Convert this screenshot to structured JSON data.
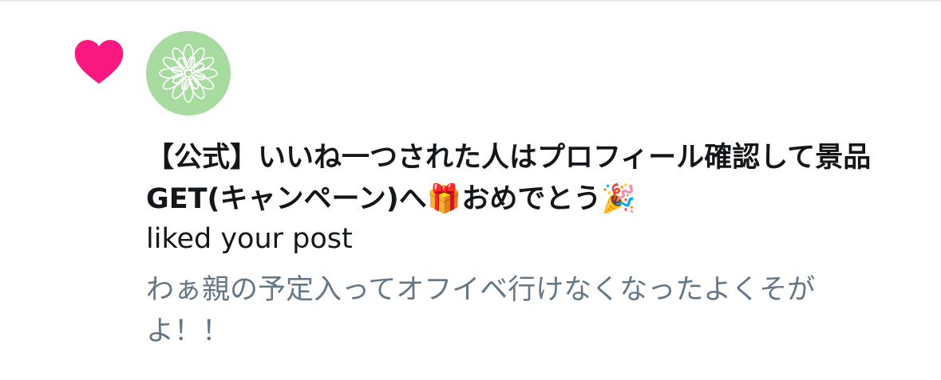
{
  "notification": {
    "type_icon": "heart-icon",
    "avatar_icon": "flower-icon",
    "display_name": "【公式】いいね一つされた人はプロフィール確認して景品GET(キャンペーン)へ🎁おめでとう🎉",
    "action": "liked your post",
    "post_text": "わぁ親の予定入ってオフイベ行けなくなったよくそがよ！！"
  },
  "colors": {
    "heart": "#f91880",
    "avatar_bg": "#a8dba0",
    "primary_text": "#14171a",
    "secondary_text": "#657786",
    "divider": "#e6ecf0"
  }
}
